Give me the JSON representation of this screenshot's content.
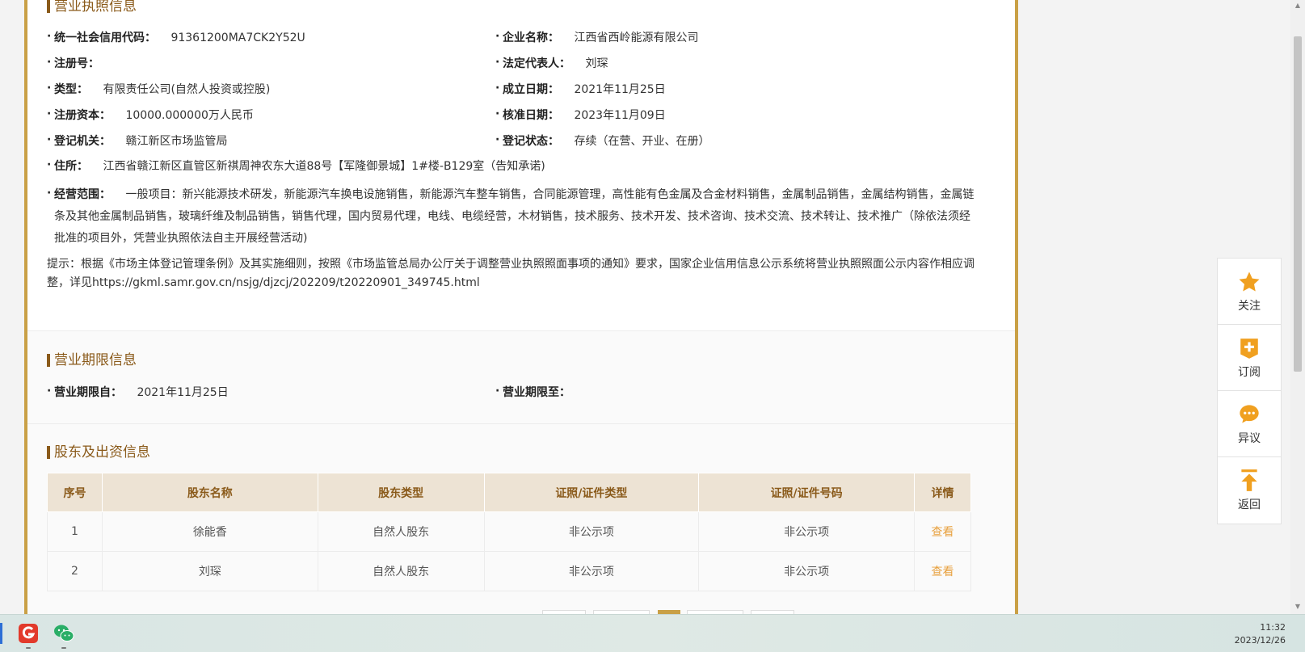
{
  "sections": {
    "license": {
      "title": "营业执照信息",
      "fields": {
        "credit_code": {
          "label": "统一社会信用代码：",
          "value": "91361200MA7CK2Y52U"
        },
        "company_name": {
          "label": "企业名称：",
          "value": "江西省西岭能源有限公司"
        },
        "reg_no": {
          "label": "注册号：",
          "value": ""
        },
        "legal_rep": {
          "label": "法定代表人：",
          "value": "刘琛"
        },
        "type": {
          "label": "类型：",
          "value": "有限责任公司(自然人投资或控股)"
        },
        "founded": {
          "label": "成立日期：",
          "value": "2021年11月25日"
        },
        "capital": {
          "label": "注册资本：",
          "value": "10000.000000万人民币"
        },
        "approved": {
          "label": "核准日期：",
          "value": "2023年11月09日"
        },
        "authority": {
          "label": "登记机关：",
          "value": "赣江新区市场监管局"
        },
        "status": {
          "label": "登记状态：",
          "value": "存续（在营、开业、在册）"
        },
        "address": {
          "label": "住所：",
          "value": "江西省赣江新区直管区新祺周神农东大道88号【军隆御景城】1#楼-B129室（告知承诺)"
        },
        "scope": {
          "label": "经营范围：",
          "value": "一般项目：新兴能源技术研发，新能源汽车换电设施销售，新能源汽车整车销售，合同能源管理，高性能有色金属及合金材料销售，金属制品销售，金属结构销售，金属链条及其他金属制品销售，玻璃纤维及制品销售，销售代理，国内贸易代理，电线、电缆经营，木材销售，技术服务、技术开发、技术咨询、技术交流、技术转让、技术推广（除依法须经批准的项目外，凭营业执照依法自主开展经营活动)"
        }
      },
      "note": "提示：根据《市场主体登记管理条例》及其实施细则，按照《市场监管总局办公厅关于调整营业执照照面事项的通知》要求，国家企业信用信息公示系统将营业执照照面公示内容作相应调整，详见https://gkml.samr.gov.cn/nsjg/djzcj/202209/t20220901_349745.html"
    },
    "period": {
      "title": "营业期限信息",
      "from": {
        "label": "营业期限自：",
        "value": "2021年11月25日"
      },
      "to": {
        "label": "营业期限至：",
        "value": ""
      }
    },
    "shareholders": {
      "title": "股东及出资信息",
      "headers": [
        "序号",
        "股东名称",
        "股东类型",
        "证照/证件类型",
        "证照/证件号码",
        "详情"
      ],
      "rows": [
        [
          "1",
          "徐能香",
          "自然人股东",
          "非公示项",
          "非公示项",
          "查看"
        ],
        [
          "2",
          "刘琛",
          "自然人股东",
          "非公示项",
          "非公示项",
          "查看"
        ]
      ]
    }
  },
  "float_toolbar": {
    "follow": {
      "label": "关注",
      "icon": "star-icon",
      "color": "#f0a020"
    },
    "subscribe": {
      "label": "订阅",
      "icon": "plus-icon",
      "color": "#f0a020"
    },
    "dispute": {
      "label": "异议",
      "icon": "chat-bubble-icon",
      "color": "#f0a020"
    },
    "back": {
      "label": "返回",
      "icon": "arrow-up-icon",
      "color": "#f0a020"
    }
  },
  "taskbar": {
    "time": "11:32",
    "date": "2023/12/26"
  },
  "colors": {
    "accent_gold": "#c9a046",
    "title_brown": "#8a5a1a",
    "link_orange": "#e8a03d",
    "table_header_bg": "#ede3d4"
  }
}
